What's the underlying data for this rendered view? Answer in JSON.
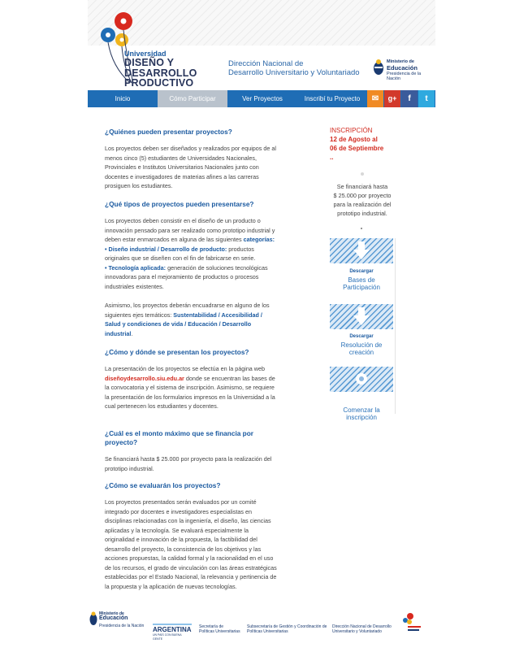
{
  "header": {
    "logo_line1": "Universidad",
    "logo_line2": "DISEÑO Y",
    "logo_line3": "DESARROLLO",
    "logo_line4": "PRODUCTIVO",
    "dn_line1": "Dirección Nacional de",
    "dn_line2": "Desarrollo Universitario y Voluntariado",
    "ministerio_t1": "Ministerio de",
    "ministerio_t2": "Educación",
    "ministerio_t3": "Presidencia de la Nación"
  },
  "nav": {
    "items": [
      "Inicio",
      "Cómo Participar",
      "Ver Proyectos",
      "Inscribí tu Proyecto"
    ],
    "active": "Cómo Participar",
    "social": [
      {
        "icon": "mail-icon",
        "glyph": "✉",
        "color": "#f08a24"
      },
      {
        "icon": "google-plus-icon",
        "glyph": "g+",
        "color": "#d2392b"
      },
      {
        "icon": "facebook-icon",
        "glyph": "f",
        "color": "#3b5b9b"
      },
      {
        "icon": "twitter-icon",
        "glyph": "t",
        "color": "#2fa9df"
      }
    ]
  },
  "faq": {
    "q1": "¿Quiénes pueden presentar proyectos?",
    "a1": "Los proyectos deben ser diseñados y realizados por equipos de al menos cinco (5) estudiantes de Universidades Nacionales, Provinciales e Institutos Universitarios Nacionales junto con docentes e investigadores de materias afines a las carreras prosiguen los estudiantes.",
    "q2": "¿Qué tipos de proyectos pueden presentarse?",
    "a2_intro": "Los proyectos deben consistir en el diseño de un producto o innovación pensado para ser realizado como prototipo industrial y deben estar enmarcados en alguna de las siguientes ",
    "a2_categorias": "categorías:",
    "a2_b1_label": "• Diseño industrial / Desarrollo de producto:",
    "a2_b1_text": " productos originales que se diseñen con el fin de fabricarse en serie.",
    "a2_b2_label": "• Tecnología aplicada:",
    "a2_b2_text": " generación de soluciones tecnológicas innovadoras para el mejoramiento de productos o procesos industriales existentes.",
    "a2_ejes_intro": "Asimismo, los proyectos deberán encuadrarse en alguno de los siguientes ejes temáticos: ",
    "a2_ejes": "Sustentabilidad / Accesibilidad / Salud y condiciones de vida / Educación / Desarrollo industrial",
    "q3": "¿Cómo y dónde se presentan los proyectos?",
    "a3_intro": "La presentación de los proyectos se efectúa en la página web ",
    "a3_link": "diseñoydesarrollo.siu.edu.ar",
    "a3_rest": " donde se encuentran las bases de la convocatoria y el sistema de inscripción. Asimismo, se requiere la presentación de los formularios impresos en la Universidad a la cual pertenecen los estudiantes y docentes.",
    "q4": "¿Cuál es el monto máximo que se financia por proyecto?",
    "a4": "Se financiará hasta $ 25.000 por proyecto para la realización del prototipo industrial.",
    "q5": "¿Cómo se evaluarán los proyectos?",
    "a5": "Los proyectos presentados serán evaluados por un comité integrado por docentes e investigadores especialistas en disciplinas relacionadas con la ingeniería, el diseño, las ciencias aplicadas y la tecnología. Se evaluará especialmente la originalidad e innovación de la propuesta, la factibilidad del desarrollo del proyecto, la consistencia de los objetivos y las acciones propuestas, la calidad formal y la racionalidad en el uso de los recursos, el grado de vinculación con las áreas estratégicas establecidas por el Estado Nacional, la relevancia y pertinencia de la propuesta y la aplicación de nuevas tecnologías."
  },
  "sidebar": {
    "ins_label": "INSCRIPCIÓN",
    "ins_date1": "12 de Agosto al",
    "ins_date2": "06 de Septiembre",
    "ins_dots": "..",
    "fin_line1": "Se financiará hasta",
    "fin_amount": "$ 25.000 por proyecto",
    "fin_line3": "para la realización del",
    "fin_line4": "prototipo industrial.",
    "dl1_small": "Descargar",
    "dl1_link": "Bases de Participación",
    "dl2_small": "Descargar",
    "dl2_link": "Resolución de creación",
    "dl3_link": "Comenzar la inscripción"
  },
  "footer": {
    "min_t1": "Ministerio de",
    "min_t2": "Educación",
    "min_t3": "Presidencia de la Nación",
    "argentina": "ARGENTINA",
    "argentina_sub": "UN PAÍS CON BUENA GENTE",
    "spu_l1": "Secretaría de",
    "spu_l2": "Políticas Universitarias",
    "sub_l1": "Subsecretaría de Gestión y Coordinación de",
    "sub_l2": "Políticas Universitarias",
    "dn_l1": "Dirección Nacional de Desarrollo",
    "dn_l2": "Universitario y Voluntariado"
  }
}
